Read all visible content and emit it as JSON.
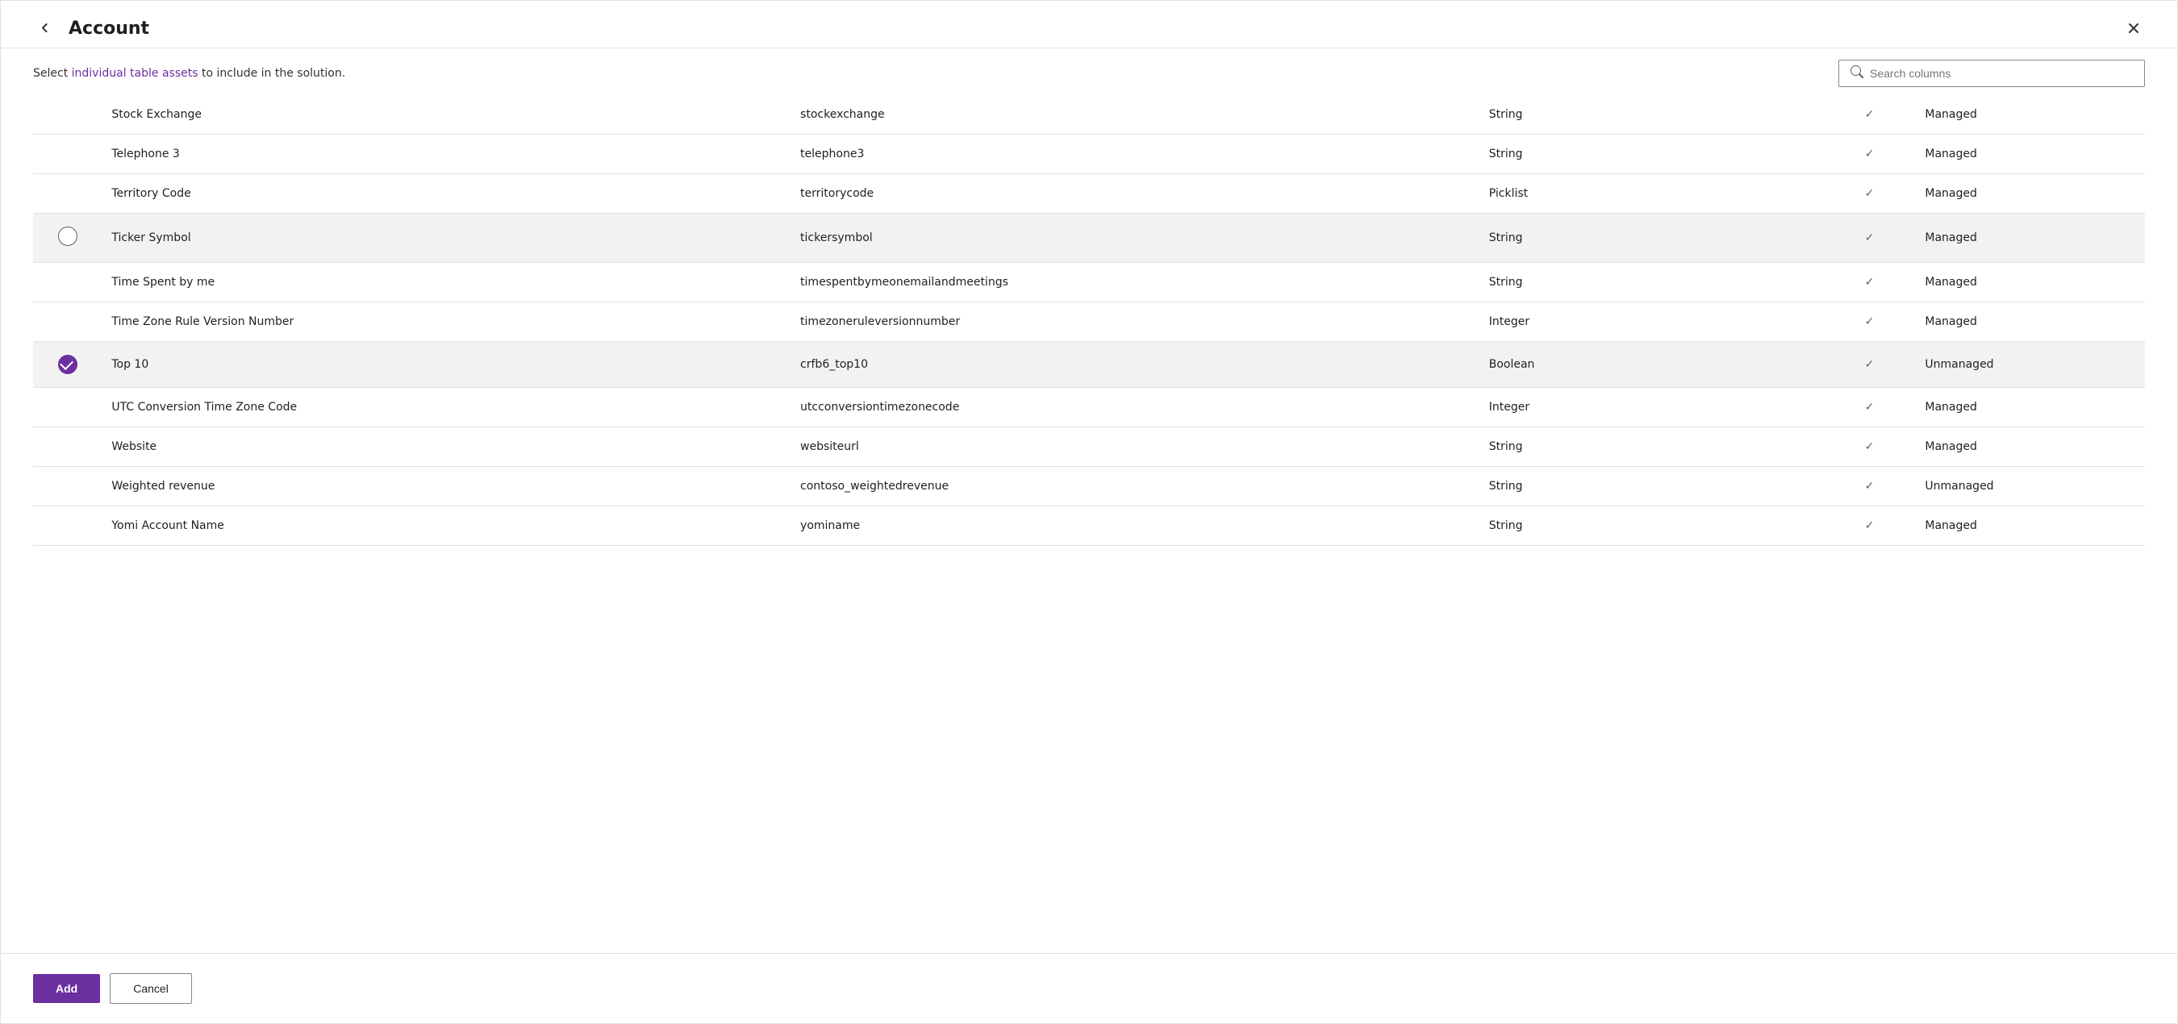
{
  "header": {
    "title": "Account",
    "close_label": "×",
    "back_label": "←"
  },
  "subtitle": {
    "text_before": "Select ",
    "highlight1": "individual table assets",
    "text_middle": " to include in the solution",
    "text_end": "."
  },
  "search": {
    "placeholder": "Search columns"
  },
  "footer": {
    "add_label": "Add",
    "cancel_label": "Cancel"
  },
  "rows": [
    {
      "id": "stock-exchange",
      "name": "Stock Exchange",
      "logical": "stockexchange",
      "type": "String",
      "has_check": true,
      "managed": "Managed",
      "selected": false
    },
    {
      "id": "telephone3",
      "name": "Telephone 3",
      "logical": "telephone3",
      "type": "String",
      "has_check": true,
      "managed": "Managed",
      "selected": false
    },
    {
      "id": "territory-code",
      "name": "Territory Code",
      "logical": "territorycode",
      "type": "Picklist",
      "has_check": true,
      "managed": "Managed",
      "selected": false
    },
    {
      "id": "ticker-symbol",
      "name": "Ticker Symbol",
      "logical": "tickersymbol",
      "type": "String",
      "has_check": true,
      "managed": "Managed",
      "selected": false,
      "highlighted": true
    },
    {
      "id": "time-spent",
      "name": "Time Spent by me",
      "logical": "timespentbymeonemailandmeetings",
      "type": "String",
      "has_check": true,
      "managed": "Managed",
      "selected": false
    },
    {
      "id": "timezone-rule",
      "name": "Time Zone Rule Version Number",
      "logical": "timezoneruleversionnumber",
      "type": "Integer",
      "has_check": true,
      "managed": "Managed",
      "selected": false
    },
    {
      "id": "top10",
      "name": "Top 10",
      "logical": "crfb6_top10",
      "type": "Boolean",
      "has_check": true,
      "managed": "Unmanaged",
      "selected": true,
      "highlighted": true
    },
    {
      "id": "utc-conversion",
      "name": "UTC Conversion Time Zone Code",
      "logical": "utcconversiontimezonecode",
      "type": "Integer",
      "has_check": true,
      "managed": "Managed",
      "selected": false
    },
    {
      "id": "website",
      "name": "Website",
      "logical": "websiteurl",
      "type": "String",
      "has_check": true,
      "managed": "Managed",
      "selected": false
    },
    {
      "id": "weighted-revenue",
      "name": "Weighted revenue",
      "logical": "contoso_weightedrevenue",
      "type": "String",
      "has_check": true,
      "managed": "Unmanaged",
      "selected": false
    },
    {
      "id": "yomi-account-name",
      "name": "Yomi Account Name",
      "logical": "yominame",
      "type": "String",
      "has_check": true,
      "managed": "Managed",
      "selected": false
    }
  ]
}
